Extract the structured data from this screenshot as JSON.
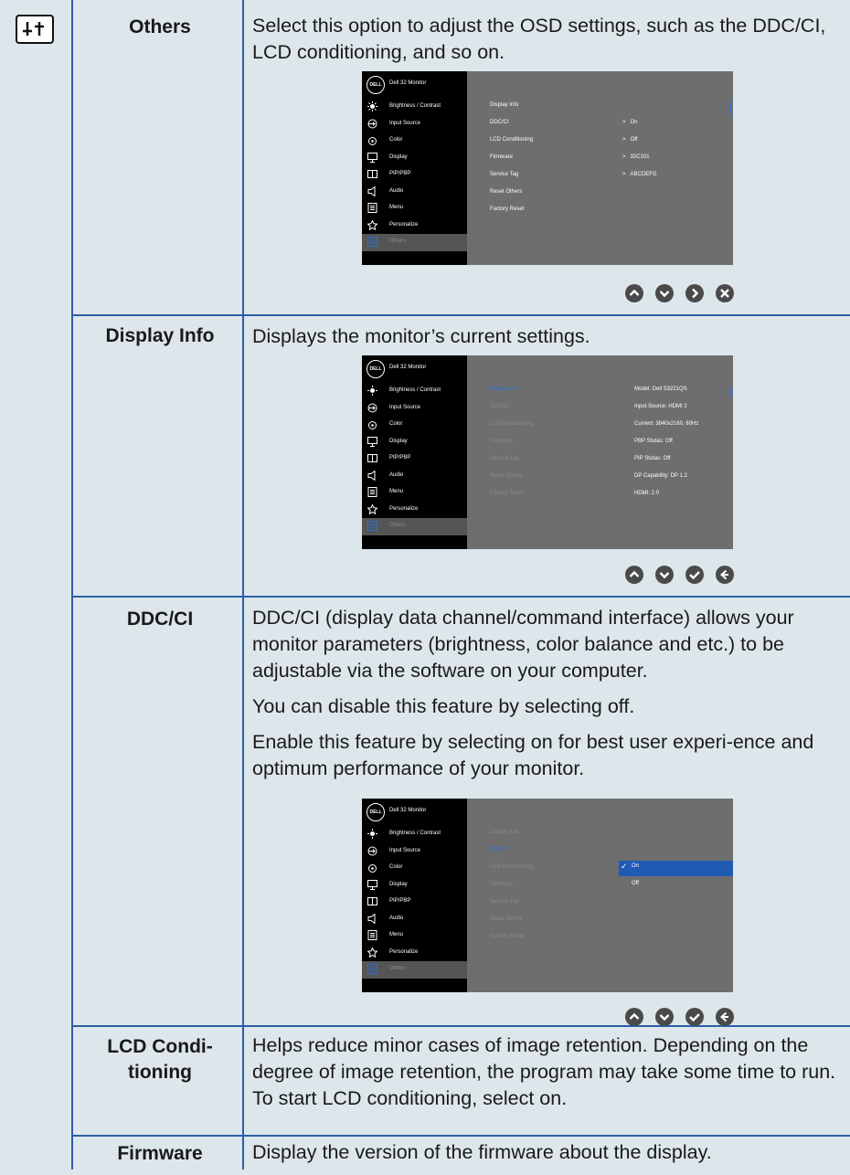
{
  "rows": [
    {
      "label": "Others",
      "paragraphs": [
        "Select this option to adjust the OSD settings, such as the DDC/CI, LCD conditioning, and so on."
      ]
    },
    {
      "label": "Display Info",
      "paragraphs": [
        "Displays the monitor’s current settings."
      ]
    },
    {
      "label": "DDC/CI",
      "paragraphs": [
        "DDC/CI (display data channel/command interface) allows your monitor parameters (brightness, color balance and etc.) to be adjustable via the software on your computer.",
        "You can disable this feature by selecting off.",
        "Enable this feature by selecting on for best user experi-ence and optimum performance of your monitor."
      ]
    },
    {
      "label_line1": "LCD Condi-",
      "label_line2": "tioning",
      "paragraphs": [
        "Helps reduce minor cases of image retention. Depending on the degree of image retention, the program may take some time to run. To start LCD conditioning, select on."
      ]
    },
    {
      "label": "Firmware",
      "paragraphs": [
        "Display the version of the firmware about the display."
      ]
    }
  ],
  "osd": {
    "logo": "DELL",
    "title": "Dell 32 Monitor",
    "menu": [
      "Brightness / Contrast",
      "Input Source",
      "Color",
      "Display",
      "PIP/PBP",
      "Audio",
      "Menu",
      "Personalize",
      "Others"
    ],
    "menu_icons": [
      "brightness-icon",
      "input-source-icon",
      "color-icon",
      "display-icon",
      "pip-pbp-icon",
      "audio-icon",
      "menu-icon",
      "personalize-icon",
      "others-icon"
    ],
    "options": [
      "Display Info",
      "DDC/CI",
      "LCD Conditioning",
      "Firmware",
      "Service Tag",
      "Reset Others",
      "Factory Reset"
    ],
    "others_values": [
      "On",
      "Off",
      "32C101",
      "ABCDEFG"
    ],
    "info_values": [
      "Model: Dell S3221QS",
      "Input Source: HDMI 2",
      "Current: 3840x2160, 60Hz",
      "PBP Stutas: Off",
      "PIP Stutas: Off",
      "DP Capability: DP 1.2",
      "HDMI: 2.0"
    ],
    "ddc_values": [
      "On",
      "Off"
    ],
    "value_arrow": ">"
  },
  "colors": {
    "rule": "#2a5fa8",
    "page": "#dde6eb",
    "osd_bg": "#6e6e6e",
    "highlight": "#1f5bb5"
  }
}
